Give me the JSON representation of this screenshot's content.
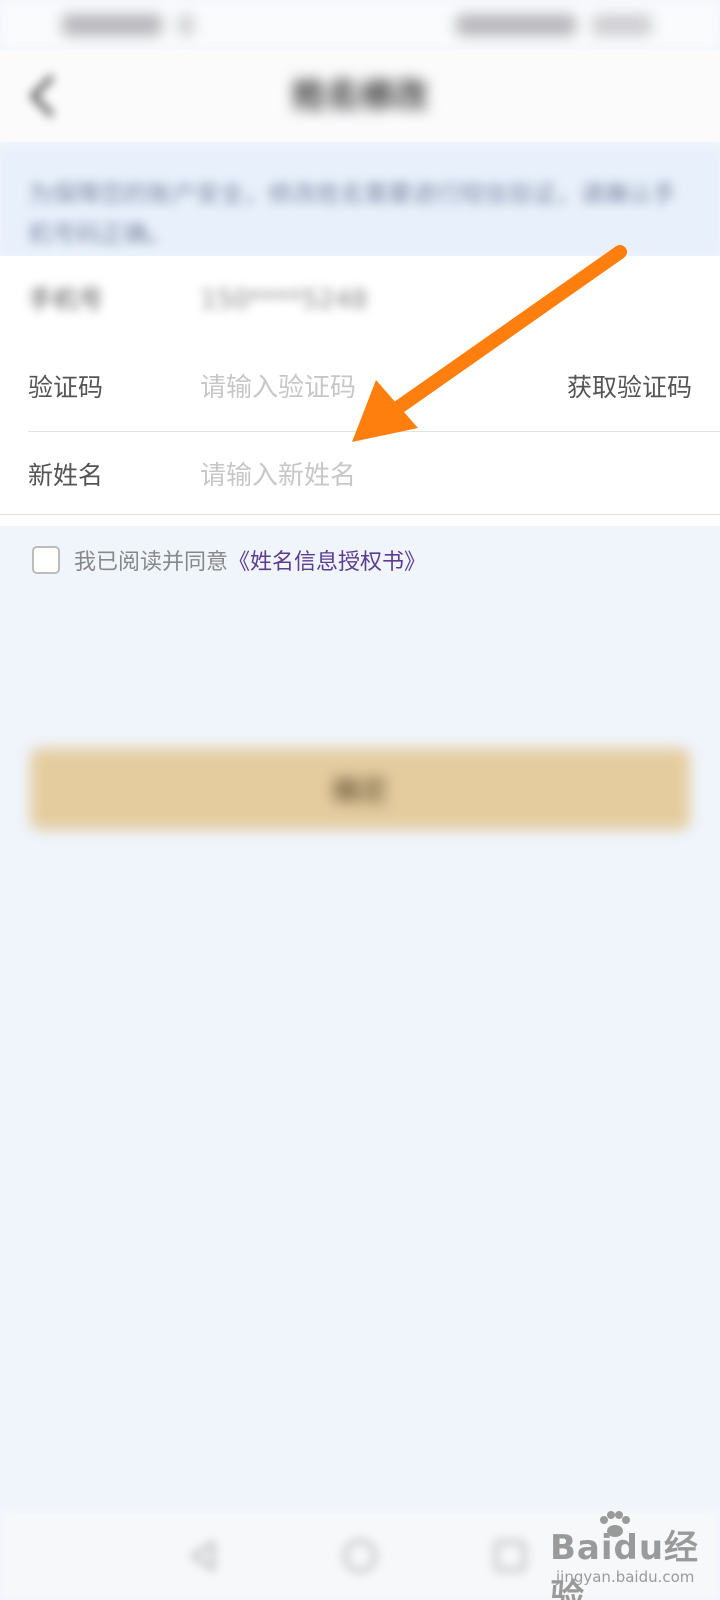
{
  "header": {
    "title": "姓名修改"
  },
  "notice": {
    "text": "为保障您的账户安全，修改姓名需要进行短信验证，请确认手机号码正确。"
  },
  "form": {
    "phone_label": "手机号",
    "phone_value": "150****5248",
    "code_label": "验证码",
    "code_placeholder": "请输入验证码",
    "get_code_label": "获取验证码",
    "name_label": "新姓名",
    "name_placeholder": "请输入新姓名"
  },
  "agreement": {
    "text": "我已阅读并同意",
    "link": "《姓名信息授权书》",
    "checked": false
  },
  "confirm_button": {
    "label": "确定"
  },
  "watermark": {
    "text": "Baidu经验",
    "url": "jingyan.baidu.com"
  },
  "colors": {
    "background": "#f0f5fc",
    "accent_button": "#e4cc9f",
    "link": "#5b3c8f",
    "arrow": "#ff7f0e"
  }
}
